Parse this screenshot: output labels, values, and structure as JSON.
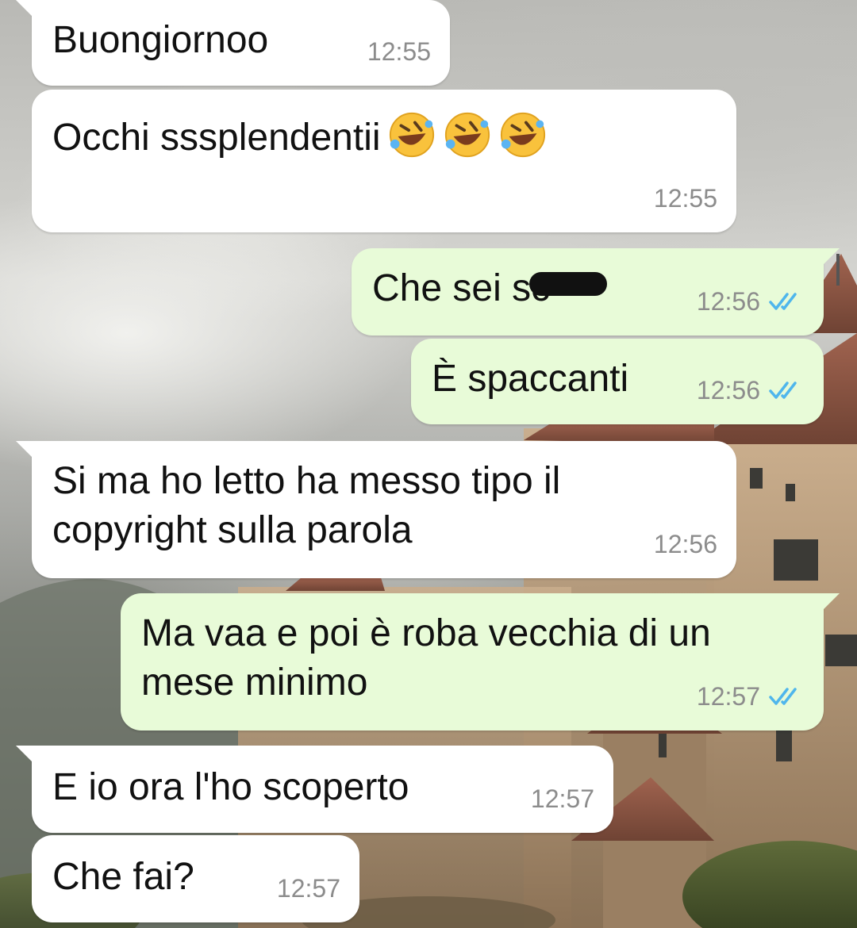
{
  "messages": [
    {
      "id": "m1",
      "direction": "incoming",
      "text": "Buongiornoo",
      "time": "12:55"
    },
    {
      "id": "m2",
      "direction": "incoming",
      "text": "Occhi sssplendentii",
      "emoji": [
        "rolling-on-floor-laughing-emoji",
        "rolling-on-floor-laughing-emoji",
        "rolling-on-floor-laughing-emoji"
      ],
      "time": "12:55"
    },
    {
      "id": "m3",
      "direction": "outgoing",
      "text": "Che sei sc",
      "redacted": true,
      "time": "12:56",
      "status": "read"
    },
    {
      "id": "m4",
      "direction": "outgoing",
      "text": "È spaccanti",
      "time": "12:56",
      "status": "read"
    },
    {
      "id": "m5",
      "direction": "incoming",
      "text": "Si ma ho letto ha messo tipo il\ncopyright sulla parola",
      "time": "12:56"
    },
    {
      "id": "m6",
      "direction": "outgoing",
      "text": "Ma vaa e poi è roba vecchia di un\nmese minimo",
      "time": "12:57",
      "status": "read"
    },
    {
      "id": "m7",
      "direction": "incoming",
      "text": "E io ora l'ho scoperto",
      "time": "12:57"
    },
    {
      "id": "m8",
      "direction": "incoming",
      "text": "Che fai?",
      "time": "12:57"
    }
  ],
  "colors": {
    "incoming_bubble": "#ffffff",
    "outgoing_bubble": "#e8fbd8",
    "read_ticks": "#4fb6ec",
    "timestamp": "#8c8c8c"
  },
  "icons": {
    "read_status": "double-check-icon"
  }
}
